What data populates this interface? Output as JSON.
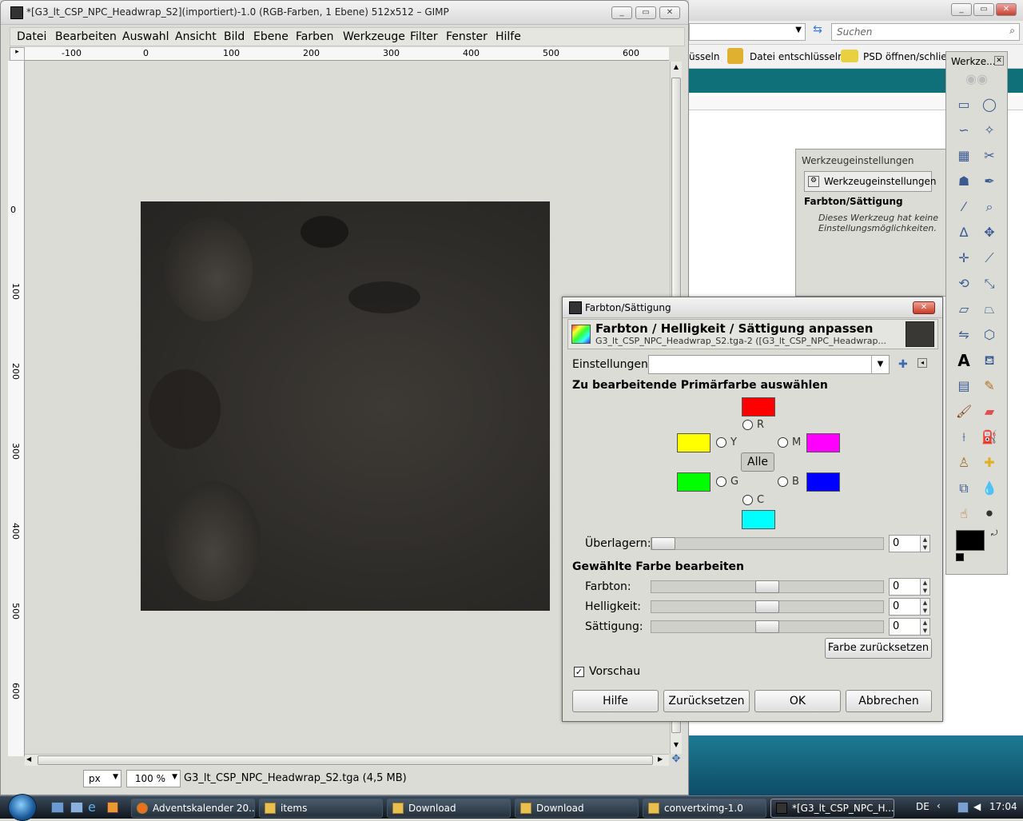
{
  "gimp": {
    "title": "*[G3_lt_CSP_NPC_Headwrap_S2](importiert)-1.0 (RGB-Farben, 1 Ebene) 512x512 – GIMP",
    "menu": [
      "Datei",
      "Bearbeiten",
      "Auswahl",
      "Ansicht",
      "Bild",
      "Ebene",
      "Farben",
      "Werkzeuge",
      "Filter",
      "Fenster",
      "Hilfe"
    ],
    "ruler_h": [
      "-100",
      "0",
      "100",
      "200",
      "300",
      "400",
      "500",
      "600"
    ],
    "ruler_v": [
      "0",
      "100",
      "200",
      "300",
      "400",
      "500",
      "600"
    ],
    "status": {
      "unit": "px",
      "zoom": "100 %",
      "info": "G3_lt_CSP_NPC_Headwrap_S2.tga (4,5 MB)"
    }
  },
  "background_window": {
    "search_placeholder": "Suchen",
    "tool_items": [
      "üsseln",
      "Datei entschlüsseln",
      "PSD öffnen/schließ"
    ]
  },
  "tool_options": {
    "title": "Werkzeugeinstellungen",
    "tab": "Werkzeugeinstellungen",
    "heading": "Farbton/Sättigung",
    "text1": "Dieses Werkzeug hat keine",
    "text2": "Einstellungsmöglichkeiten."
  },
  "toolbox": {
    "title": "Werkze..."
  },
  "dialog": {
    "window_title": "Farbton/Sättigung",
    "heading": "Farbton / Helligkeit / Sättigung anpassen",
    "subtitle": "G3_lt_CSP_NPC_Headwrap_S2.tga-2 ([G3_lt_CSP_NPC_Headwrap...",
    "settings_label": "Einstellungen:",
    "primary_heading": "Zu bearbeitende Primärfarbe auswählen",
    "radios": {
      "r": "R",
      "y": "Y",
      "m": "M",
      "g": "G",
      "b": "B",
      "c": "C"
    },
    "all_button": "Alle",
    "overlap_label": "Überlagern:",
    "overlap_value": "0",
    "edit_heading": "Gewählte Farbe bearbeiten",
    "hue_label": "Farbton:",
    "hue_value": "0",
    "lightness_label": "Helligkeit:",
    "lightness_value": "0",
    "saturation_label": "Sättigung:",
    "saturation_value": "0",
    "reset_color": "Farbe zurücksetzen",
    "preview_label": "Vorschau",
    "help": "Hilfe",
    "reset": "Zurücksetzen",
    "ok": "OK",
    "cancel": "Abbrechen",
    "colors": {
      "red": "#ff0000",
      "yellow": "#ffff00",
      "magenta": "#ff00ff",
      "green": "#00ff00",
      "blue": "#0000ff",
      "cyan": "#00ffff"
    }
  },
  "taskbar": {
    "items": [
      "Adventskalender 20...",
      "items",
      "Download",
      "Download",
      "convertximg-1.0",
      "*[G3_lt_CSP_NPC_H..."
    ],
    "lang": "DE",
    "clock": "17:04"
  }
}
